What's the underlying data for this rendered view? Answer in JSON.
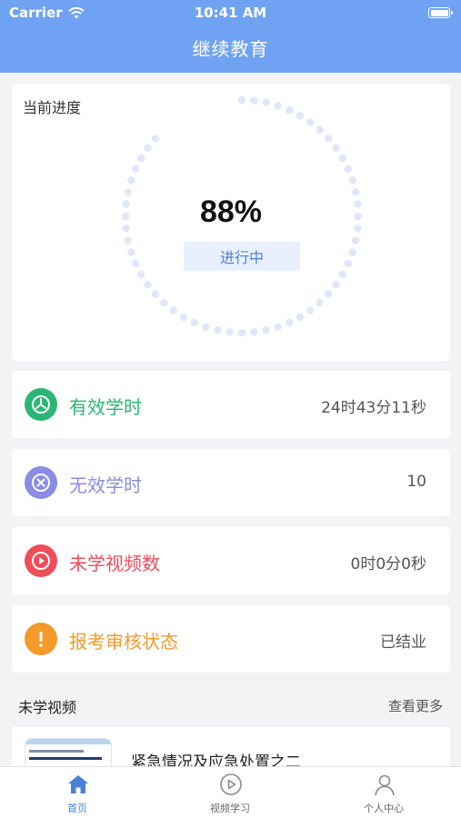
{
  "status_bar": {
    "carrier": "Carrier",
    "time": "10:41 AM"
  },
  "header": {
    "title": "继续教育"
  },
  "progress": {
    "label": "当前进度",
    "percent_text": "88%",
    "percent_value": 88,
    "status": "进行中"
  },
  "stats": [
    {
      "label": "有效学时",
      "value": "24时43分11秒",
      "icon": "clock-icon",
      "color": "#2bb673"
    },
    {
      "label": "无效学时",
      "value": "10",
      "icon": "close-circle-icon",
      "color": "#8a8ce6"
    },
    {
      "label": "未学视频数",
      "value": "0时0分0秒",
      "icon": "play-icon",
      "color": "#ef4d5a"
    },
    {
      "label": "报考审核状态",
      "value": "已结业",
      "icon": "exclamation-icon",
      "color": "#f39a2b"
    }
  ],
  "videos_section": {
    "title": "未学视频",
    "more": "查看更多"
  },
  "videos": [
    {
      "title": "紧急情况及应急处置之二"
    }
  ],
  "tabs": [
    {
      "label": "首页",
      "icon": "home-icon",
      "active": true
    },
    {
      "label": "视频学习",
      "icon": "play-circle-icon",
      "active": false
    },
    {
      "label": "个人中心",
      "icon": "user-icon",
      "active": false
    }
  ],
  "colors": {
    "header_bg": "#6fa2f3",
    "accent": "#4a80d8",
    "ring_dot": "#dfe8f8"
  }
}
